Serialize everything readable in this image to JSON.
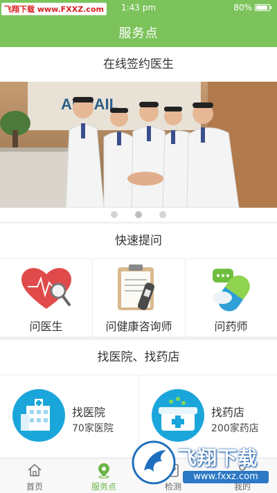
{
  "status_bar": {
    "time": "1:43 pm",
    "battery_text": "80%",
    "battery_level": 0.8
  },
  "watermark_top": "飞翔下载 www.FXXZ.com",
  "header": {
    "title": "服务点"
  },
  "banner": {
    "title": "在线签约医生",
    "sign_text": "ARRAIL",
    "slide_count": 3,
    "active_slide": 1
  },
  "quick": {
    "title": "快速提问",
    "items": [
      {
        "label": "问医生",
        "icon": "heart-stethoscope-icon"
      },
      {
        "label": "问健康咨询师",
        "icon": "clipboard-thermometer-icon"
      },
      {
        "label": "问药师",
        "icon": "pill-capsule-icon"
      }
    ]
  },
  "find": {
    "title": "找医院、找药店",
    "items": [
      {
        "name": "找医院",
        "count": "70家医院",
        "icon": "hospital-building-icon"
      },
      {
        "name": "找药店",
        "count": "200家药店",
        "icon": "medicine-box-icon"
      }
    ]
  },
  "tabs": [
    {
      "label": "首页",
      "icon": "home-icon",
      "active": false
    },
    {
      "label": "服务点",
      "icon": "location-pin-icon",
      "active": true
    },
    {
      "label": "检测",
      "icon": "checkup-icon",
      "active": false
    },
    {
      "label": "我的",
      "icon": "user-icon",
      "active": false
    }
  ],
  "watermark_bottom": {
    "text": "飞翔下载",
    "url": "www.fxxz.com"
  },
  "colors": {
    "brand_green": "#7cc35c",
    "tab_active": "#6ab547",
    "find_circle": "#1ba6db"
  }
}
